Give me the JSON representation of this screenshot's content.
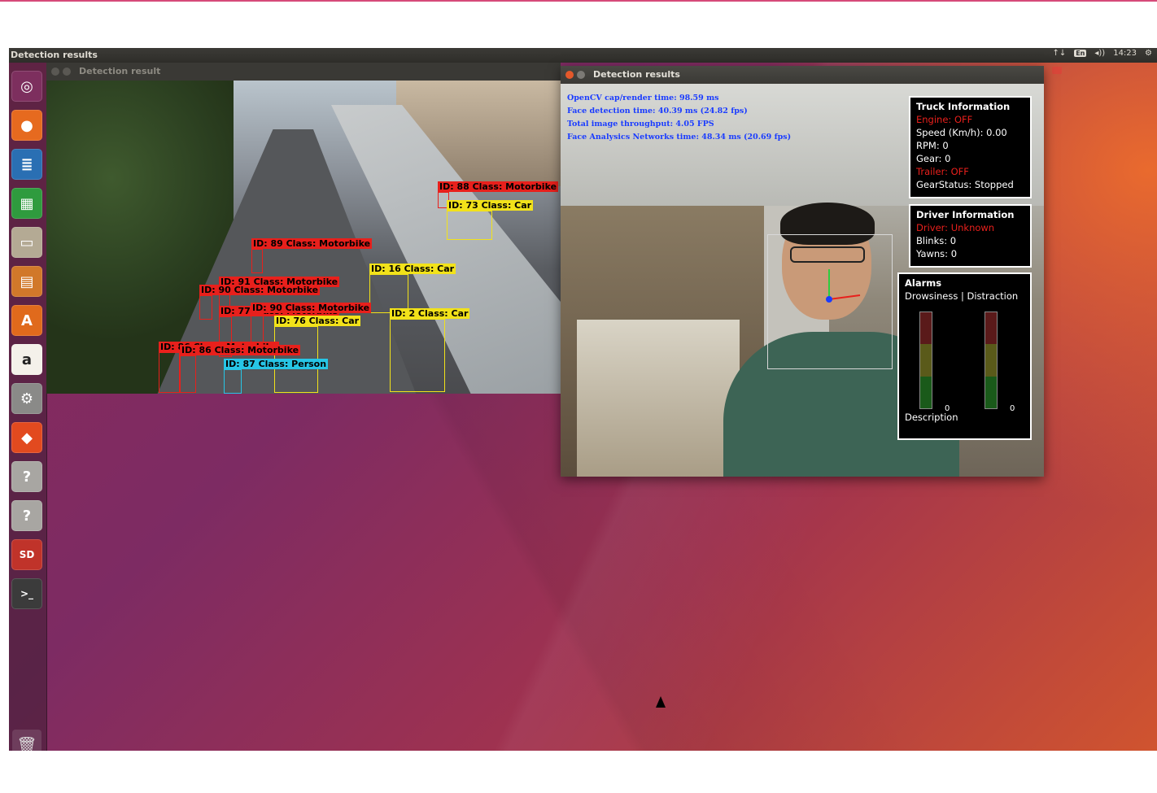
{
  "desktop": {
    "topbar_title": "Detection results",
    "clock": "14:23",
    "input_lang": "En",
    "volume_glyph": "◂))",
    "network_glyph": "↑↓",
    "settings_glyph": "⚙"
  },
  "launcher": {
    "items": [
      {
        "name": "dash-icon",
        "glyph": "◎",
        "color": "#7d2f5e"
      },
      {
        "name": "firefox-icon",
        "glyph": "●",
        "color": "#e66a1f"
      },
      {
        "name": "writer-icon",
        "glyph": "≣",
        "color": "#2a6fb3"
      },
      {
        "name": "calc-icon",
        "glyph": "▦",
        "color": "#2f9b3e"
      },
      {
        "name": "files-icon",
        "glyph": "▭",
        "color": "#b4aa94"
      },
      {
        "name": "impress-icon",
        "glyph": "▤",
        "color": "#d1782a"
      },
      {
        "name": "software-center-icon",
        "glyph": "A",
        "color": "#e06a1c"
      },
      {
        "name": "amazon-icon",
        "glyph": "a",
        "color": "#f4f1ea"
      },
      {
        "name": "system-settings-icon",
        "glyph": "⚙",
        "color": "#8a8a88"
      },
      {
        "name": "git-icon",
        "glyph": "◆",
        "color": "#e24a1f"
      },
      {
        "name": "unknown-app-icon",
        "glyph": "?",
        "color": "#a8a6a2"
      },
      {
        "name": "unknown-app-icon-2",
        "glyph": "?",
        "color": "#a8a6a2"
      },
      {
        "name": "sd-card-icon",
        "glyph": "SD",
        "color": "#c0332a"
      },
      {
        "name": "terminal-icon",
        "glyph": ">_",
        "color": "#3b3b3b"
      }
    ],
    "trash_glyph": "🗑"
  },
  "window_traffic": {
    "title": "Detection result",
    "detections": [
      {
        "label": "ID: 88 Class: Motorbike",
        "color": "red"
      },
      {
        "label": "ID: 73 Class: Car",
        "color": "yel"
      },
      {
        "label": "ID: 89 Class: Motorbike",
        "color": "red"
      },
      {
        "label": "ID: 16 Class: Car",
        "color": "yel"
      },
      {
        "label": "ID: 91 Class: Motorbike",
        "color": "red"
      },
      {
        "label": "ID: 90 Class: Motorbike",
        "color": "red"
      },
      {
        "label": "ID: 77 Class: Motorbike",
        "color": "red"
      },
      {
        "label": "ID: 90 Class: Motorbike",
        "color": "red"
      },
      {
        "label": "ID: 76 Class: Car",
        "color": "yel"
      },
      {
        "label": "ID: 2 Class: Car",
        "color": "yel"
      },
      {
        "label": "ID: 86 Class: Motorbike",
        "color": "red"
      },
      {
        "label": "ID: 86 Class: Motorbike",
        "color": "red"
      },
      {
        "label": "ID: 87 Class: Person",
        "color": "cyan"
      }
    ]
  },
  "window_driver": {
    "title": "Detection results",
    "stats": [
      "OpenCV cap/render time: 98.59 ms",
      "Face detection time: 40.39 ms (24.82 fps)",
      "Total image throughput: 4.05 FPS",
      "Face Analysics Networks time: 48.34 ms (20.69 fps)"
    ],
    "truck_info": {
      "heading": "Truck Information",
      "engine": "Engine: OFF",
      "speed": "Speed (Km/h): 0.00",
      "rpm": "RPM: 0",
      "gear": "Gear: 0",
      "trailer": "Trailer: OFF",
      "gear_status": "GearStatus: Stopped"
    },
    "driver_info": {
      "heading": "Driver Information",
      "driver": "Driver: Unknown",
      "blinks": "Blinks: 0",
      "yawns": "Yawns: 0"
    },
    "alarms": {
      "heading": "Alarms",
      "columns": "Drowsiness | Distraction",
      "drowsiness_value": "0",
      "distraction_value": "0",
      "description": "Description",
      "drowsiness_level": 0,
      "distraction_level": 0
    }
  }
}
